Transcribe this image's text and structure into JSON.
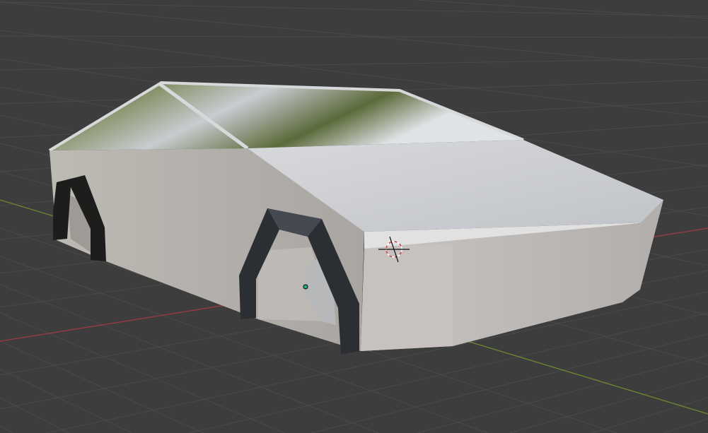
{
  "viewport": {
    "mode": "3d-viewport",
    "background_color": "#3d3d3d",
    "grid_color": "#4a4a4a",
    "x_axis_color": "#9b3a45",
    "y_axis_color": "#6e8a2e"
  },
  "scene": {
    "object": "truck-model",
    "body_color": "#c9c6c4",
    "trim_color": "#2a2c30",
    "glass_tint": "#7d8a5a"
  },
  "icons": {
    "cursor": "3d-cursor-icon",
    "origin": "object-origin-icon"
  }
}
